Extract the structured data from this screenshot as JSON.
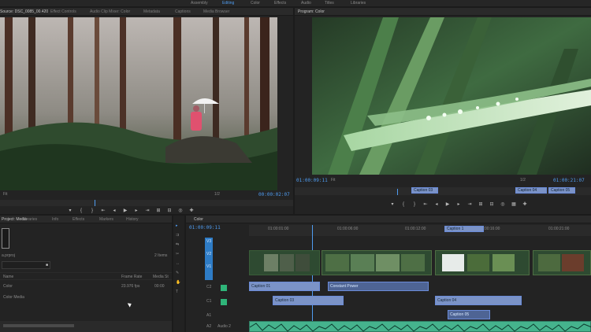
{
  "workspaces": [
    "Assembly",
    "Editing",
    "Color",
    "Effects",
    "Audio",
    "Titles",
    "Libraries"
  ],
  "active_workspace": "Editing",
  "source_panel": {
    "tabs": [
      "Source: DSC_0085_00.420",
      "Effect Controls",
      "Audio Clip Mixer: Color",
      "Metadata",
      "Captions",
      "Media Browser"
    ],
    "fit": "Fit",
    "scale": "1/2",
    "timecode_right": "00:00:02:07"
  },
  "program_panel": {
    "tabs": [
      "Program: Color"
    ],
    "timecode_left": "01:00:09:11",
    "fit": "Fit",
    "scale": "1/2",
    "timecode_right": "01:00:21:07",
    "marker_labels": [
      "Caption 03",
      "Caption 04",
      "Caption 05"
    ]
  },
  "project_panel": {
    "tabs": [
      "Project: Media",
      "Libraries",
      "Info",
      "Effects",
      "Markers",
      "History"
    ],
    "filename": "a.prproj",
    "items_count": "2 Items",
    "columns": [
      "Name",
      "Frame Rate",
      "Media St"
    ],
    "rows": [
      {
        "name": "Color",
        "rate": "23.976 fps",
        "media_start": "00:00"
      },
      {
        "name": "Color Media",
        "rate": "",
        "media_start": ""
      }
    ]
  },
  "timeline": {
    "tabs": [
      "Color"
    ],
    "timecode": "01:00:09:11",
    "ruler": [
      "01:00:01:00",
      "01:00:06:00",
      "01:00:12:00",
      "01:00:16:00",
      "01:00:21:00"
    ],
    "tracks": [
      {
        "name": "V3"
      },
      {
        "name": "V2"
      },
      {
        "name": "V1"
      },
      {
        "name": "C2"
      },
      {
        "name": "C1"
      },
      {
        "name": "A1"
      },
      {
        "name": "A2"
      },
      {
        "name": "Audio 2"
      }
    ],
    "caption_clips": [
      "Caption 01",
      "Caption 03",
      "Caption 04",
      "Caption 05",
      "Constant Power"
    ],
    "marker_label": "Caption 1"
  },
  "colors": {
    "accent": "#4f9cf0",
    "panel": "#232323",
    "clip_blue": "#7b93c7",
    "clip_green": "#45b38d"
  }
}
